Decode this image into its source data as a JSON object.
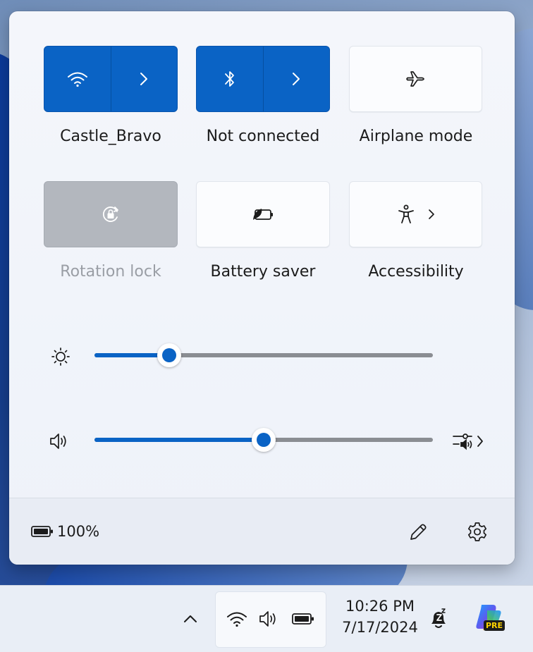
{
  "quick_settings": {
    "wifi": {
      "label": "Castle_Bravo"
    },
    "bluetooth": {
      "label": "Not connected"
    },
    "airplane": {
      "label": "Airplane mode"
    },
    "rotation": {
      "label": "Rotation lock"
    },
    "battery_saver": {
      "label": "Battery saver"
    },
    "accessibility": {
      "label": "Accessibility"
    }
  },
  "sliders": {
    "brightness": {
      "value": 0.22
    },
    "volume": {
      "value": 0.5
    }
  },
  "footer": {
    "battery_percent": "100%"
  },
  "taskbar": {
    "time": "10:26 PM",
    "date": "7/17/2024",
    "copilot_badge": "PRE"
  },
  "colors": {
    "accent": "#0a63c5"
  }
}
